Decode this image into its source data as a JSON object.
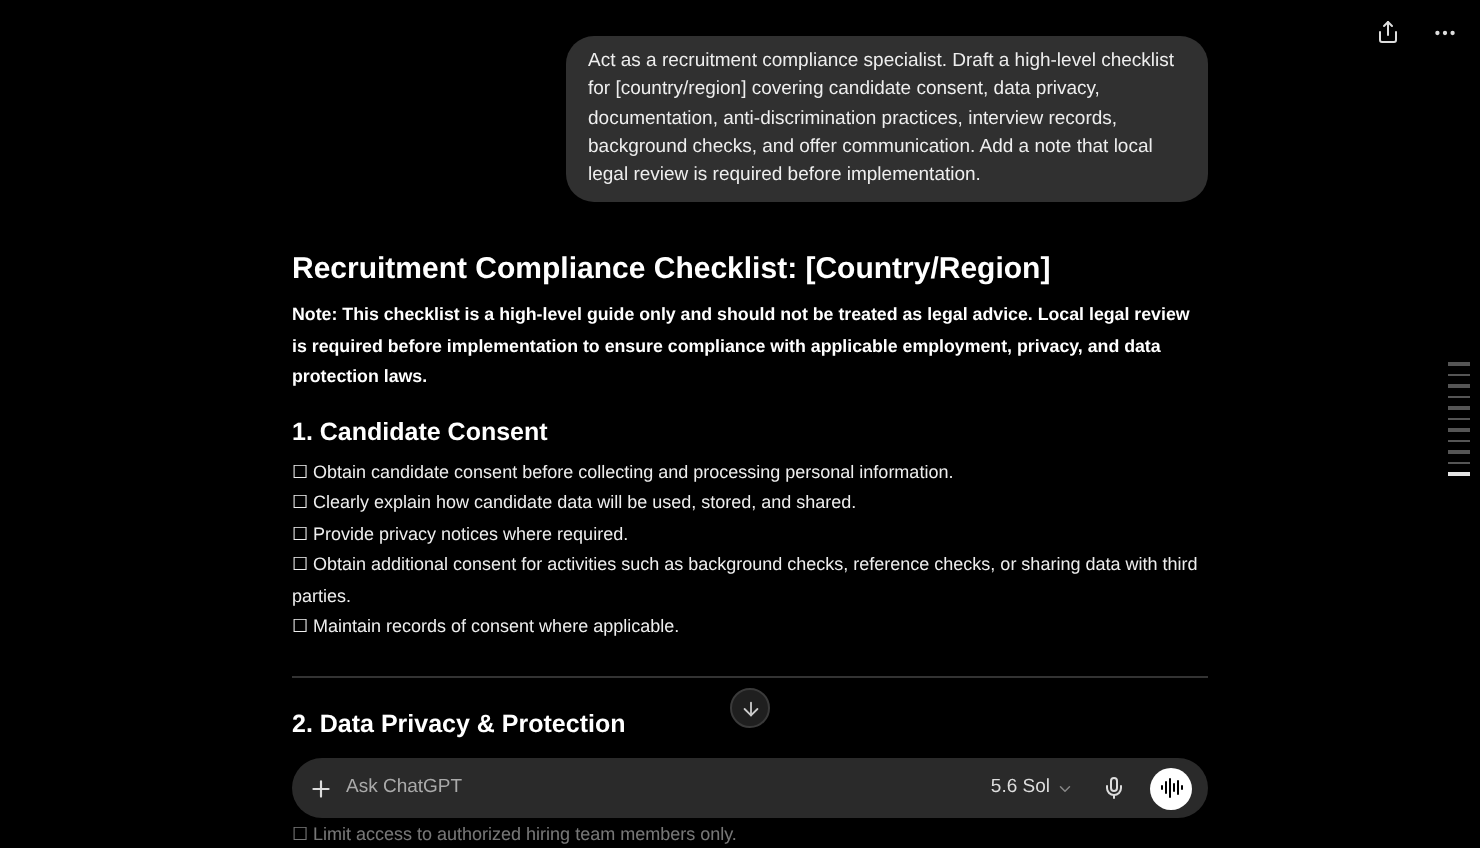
{
  "top_actions": [
    {
      "kind": "share"
    },
    {
      "kind": "more"
    }
  ],
  "user_message": "Act as a recruitment compliance specialist. Draft a high-level checklist for [country/region] covering candidate consent, data privacy, documentation, anti-discrimination practices, interview records, background checks, and offer communication. Add a note that local legal review is required before implementation.",
  "response": {
    "title": "Recruitment Compliance Checklist: [Country/Region]",
    "note": "Note: This checklist is a high-level guide only and should not be treated as legal advice. Local legal review is required before implementation to ensure compliance with applicable employment, privacy, and data protection laws.",
    "sections": [
      {
        "heading": "1. Candidate Consent",
        "items": [
          "☐ Obtain candidate consent before collecting and processing personal information.",
          "☐ Clearly explain how candidate data will be used, stored, and shared.",
          "☐ Provide privacy notices where required.",
          "☐ Obtain additional consent for activities such as background checks, reference checks, or sharing data with third parties.",
          "☐ Maintain records of consent where applicable."
        ]
      },
      {
        "heading": "2. Data Privacy & Protection",
        "items": [
          "☐ Limit access to authorized hiring team members only."
        ]
      }
    ]
  },
  "outline": [
    {
      "selected": false
    },
    {
      "selected": false
    },
    {
      "selected": false
    },
    {
      "selected": false
    },
    {
      "selected": false
    },
    {
      "selected": false
    },
    {
      "selected": false
    },
    {
      "selected": false
    },
    {
      "selected": false
    },
    {
      "selected": false
    },
    {
      "selected": true
    }
  ],
  "composer": {
    "placeholder": "Ask ChatGPT",
    "model": "5.6 Sol"
  }
}
